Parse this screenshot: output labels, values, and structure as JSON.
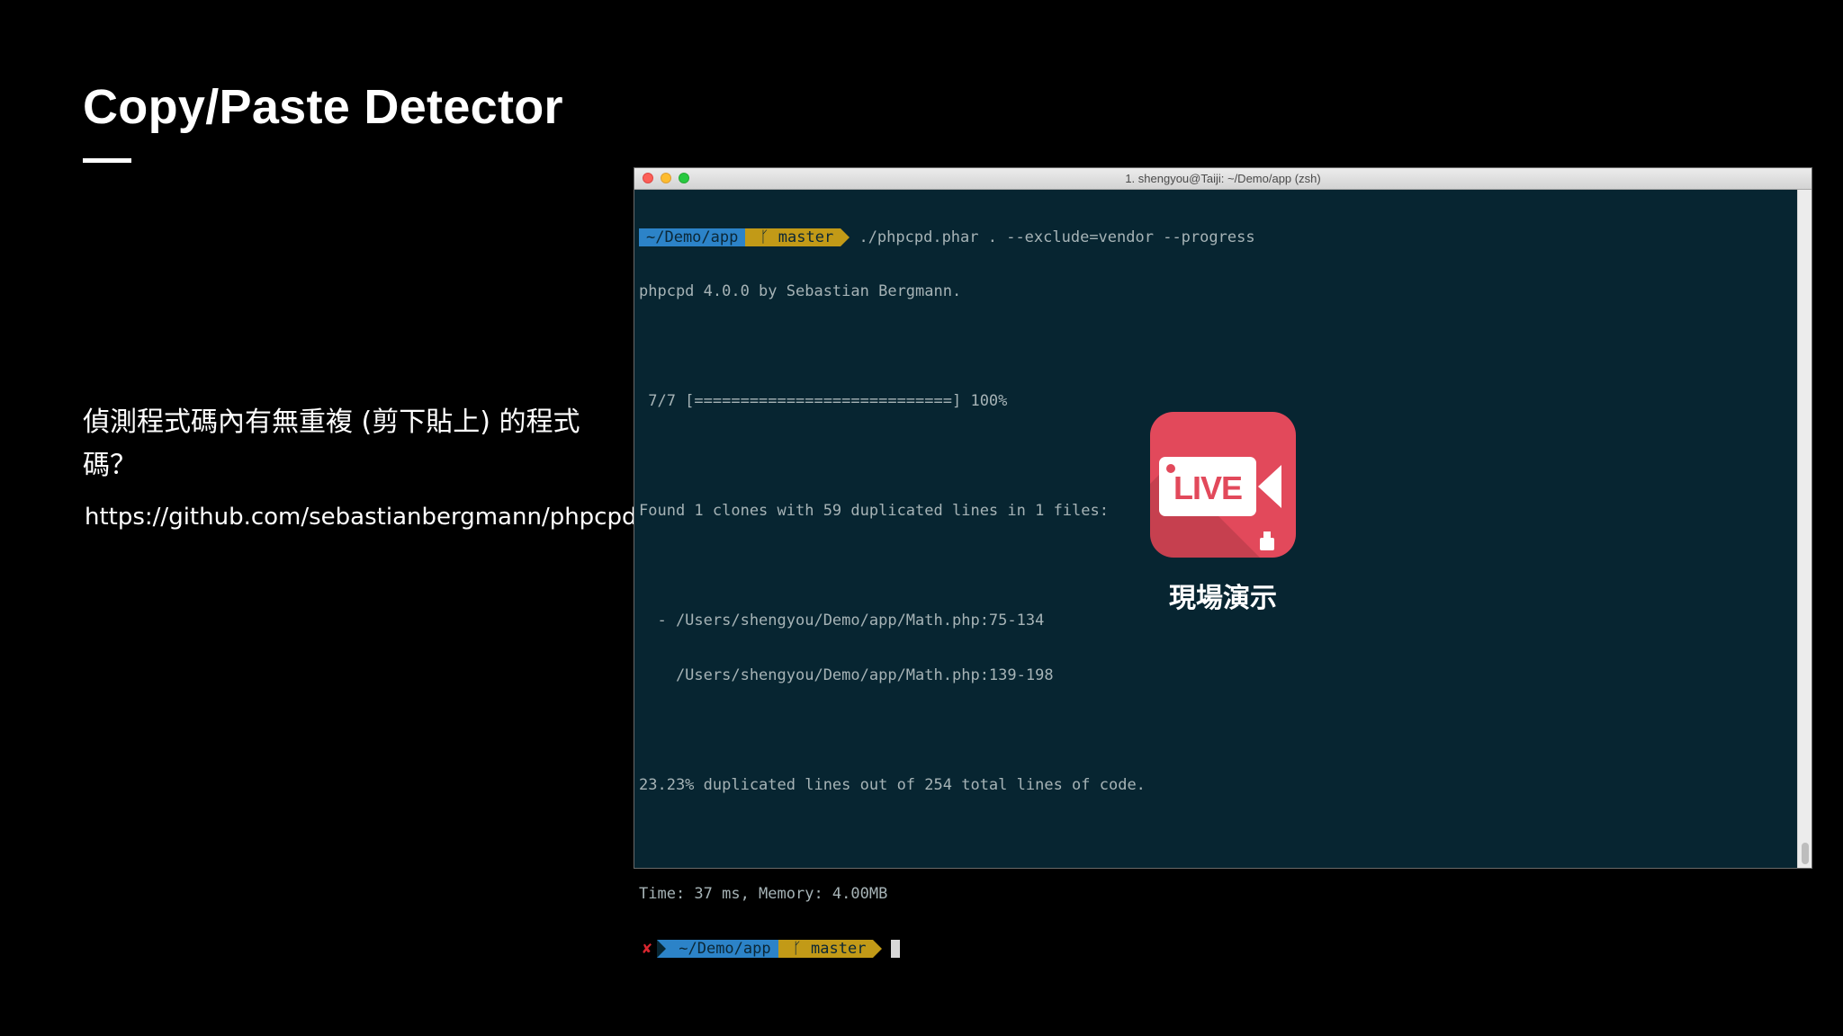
{
  "slide": {
    "title": "Copy/Paste Detector",
    "description": "偵測程式碼內有無重複 (剪下貼上) 的程式碼？",
    "link": "https://github.com/sebastianbergmann/phpcpd"
  },
  "terminal": {
    "window_title": "1. shengyou@Taiji: ~/Demo/app (zsh)",
    "prompt_dir": "~/Demo/app",
    "prompt_branch": "ᚴ master",
    "command": " ./phpcpd.phar . --exclude=vendor --progress",
    "lines": [
      "phpcpd 4.0.0 by Sebastian Bergmann.",
      "",
      " 7/7 [============================] 100%",
      "",
      "Found 1 clones with 59 duplicated lines in 1 files:",
      "",
      "  - /Users/shengyou/Demo/app/Math.php:75-134",
      "    /Users/shengyou/Demo/app/Math.php:139-198",
      "",
      "23.23% duplicated lines out of 254 total lines of code.",
      "",
      "Time: 37 ms, Memory: 4.00MB"
    ],
    "error_mark": "✘",
    "colors": {
      "background": "#072531",
      "prompt_blue": "#2c83c8",
      "prompt_yellow": "#c29a17",
      "error_red": "#d8262f"
    }
  },
  "live_badge": {
    "label": "LIVE",
    "caption": "現場演示",
    "color": "#e2495b"
  }
}
